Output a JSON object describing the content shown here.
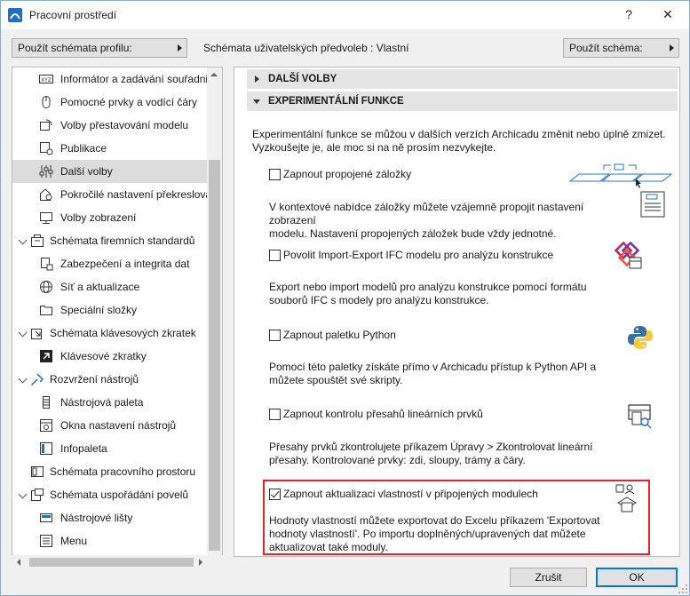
{
  "window": {
    "title": "Pracovní prostředí",
    "help": "?",
    "close": "✕"
  },
  "toolbar": {
    "profile_button": "Použít schémata profilu:",
    "pref_label": "Schémata uživatelských předvoleb :  Vlastní",
    "schema_button": "Použít schéma:"
  },
  "tree": {
    "items": [
      {
        "label": "Informátor a zadávání souřadnic",
        "icon": "xyz-icon"
      },
      {
        "label": "Pomocné prvky a vodící čáry",
        "icon": "mouse-icon"
      },
      {
        "label": "Volby přestavování modelu",
        "icon": "rebuild-icon"
      },
      {
        "label": "Publikace",
        "icon": "publish-icon"
      },
      {
        "label": "Další volby",
        "icon": "sliders-icon"
      },
      {
        "label": "Pokročilé nastavení překreslování",
        "icon": "house-gear-icon"
      },
      {
        "label": "Volby zobrazení",
        "icon": "display-icon"
      },
      {
        "label": "Schémata firemních standardů",
        "icon": "company-icon"
      },
      {
        "label": "Zabezpečení a integrita dat",
        "icon": "security-icon"
      },
      {
        "label": "Síť a aktualizace",
        "icon": "globe-icon"
      },
      {
        "label": "Speciální složky",
        "icon": "folder-icon"
      },
      {
        "label": "Schémata klávesových zkratek",
        "icon": "keyboard-icon"
      },
      {
        "label": "Klávesové zkratky",
        "icon": "shortcut-icon"
      },
      {
        "label": "Rozvržení nástrojů",
        "icon": "tools-icon"
      },
      {
        "label": "Nástrojová paleta",
        "icon": "palette-icon"
      },
      {
        "label": "Okna nastavení nástrojů",
        "icon": "tool-settings-icon"
      },
      {
        "label": "Infopaleta",
        "icon": "info-icon"
      },
      {
        "label": "Schémata pracovního prostoru",
        "icon": "workspace-icon"
      },
      {
        "label": "Schémata uspořádání povelů",
        "icon": "commands-icon"
      },
      {
        "label": "Nástrojové lišty",
        "icon": "toolbar-icon"
      },
      {
        "label": "Menu",
        "icon": "menu-icon"
      }
    ]
  },
  "panel": {
    "section1": "DALŠÍ VOLBY",
    "section2": "EXPERIMENTÁLNÍ FUNKCE",
    "intro_line1": "Experimentální funkce se můžou v dalších verzích Archicadu změnit nebo úplně zmizet.",
    "intro_line2": "Vyzkoušejte je, ale moc si na ně prosím nezvykejte.",
    "options": [
      {
        "label": "Zapnout propojené záložky",
        "checked": false,
        "desc1": "V kontextové nabídce záložky můžete vzájemně propojit nastavení zobrazení",
        "desc2": "modelu. Nastavení propojených záložek bude vždy jednotné."
      },
      {
        "label": "Povolit Import-Export IFC modelu pro analýzu konstrukce",
        "checked": false,
        "desc1": "Export nebo import modelů pro analýzu konstrukce pomocí formátu",
        "desc2": "souborů IFC s modely pro analýzu konstrukce."
      },
      {
        "label": "Zapnout paletku Python",
        "checked": false,
        "desc1": "Pomocí této paletky získáte přímo v Archicadu přístup k Python API a",
        "desc2": "můžete spouštět své skripty."
      },
      {
        "label": "Zapnout kontrolu přesahů lineárních prvků",
        "checked": false,
        "desc1": "Přesahy prvků zkontrolujete příkazem Úpravy > Zkontrolovat lineární",
        "desc2": "přesahy. Kontrolované prvky: zdi, sloupy, trámy a čáry."
      },
      {
        "label": "Zapnout aktualizaci vlastností v připojených modulech",
        "checked": true,
        "desc1": "Hodnoty vlastností můžete exportovat do Excelu příkazem 'Exportovat",
        "desc2": "hodnoty vlastností'. Po importu doplněných/upravených dat můžete",
        "desc3": "aktualizovat také moduly."
      }
    ]
  },
  "footer": {
    "cancel": "Zrušit",
    "ok": "OK"
  },
  "colors": {
    "highlight": "#e0242a",
    "accent": "#0078d7"
  }
}
